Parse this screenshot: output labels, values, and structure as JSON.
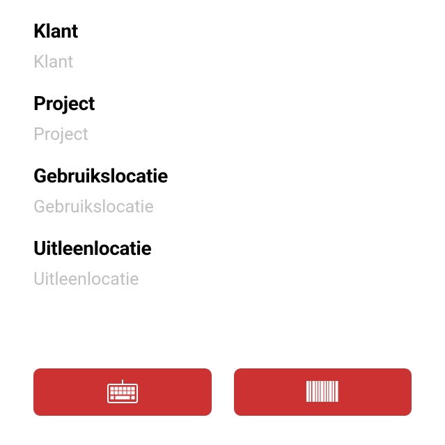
{
  "fields": {
    "klant": {
      "label": "Klant",
      "placeholder": "Klant"
    },
    "project": {
      "label": "Project",
      "placeholder": "Project"
    },
    "gebruikslocatie": {
      "label": "Gebruikslocatie",
      "placeholder": "Gebruikslocatie"
    },
    "uitleenlocatie": {
      "label": "Uitleenlocatie",
      "placeholder": "Uitleenlocatie"
    }
  },
  "buttons": {
    "keyboard": "keyboard-icon",
    "barcode": "barcode-icon"
  },
  "colors": {
    "accent": "#cc3232",
    "placeholder": "#bfbfbf"
  }
}
